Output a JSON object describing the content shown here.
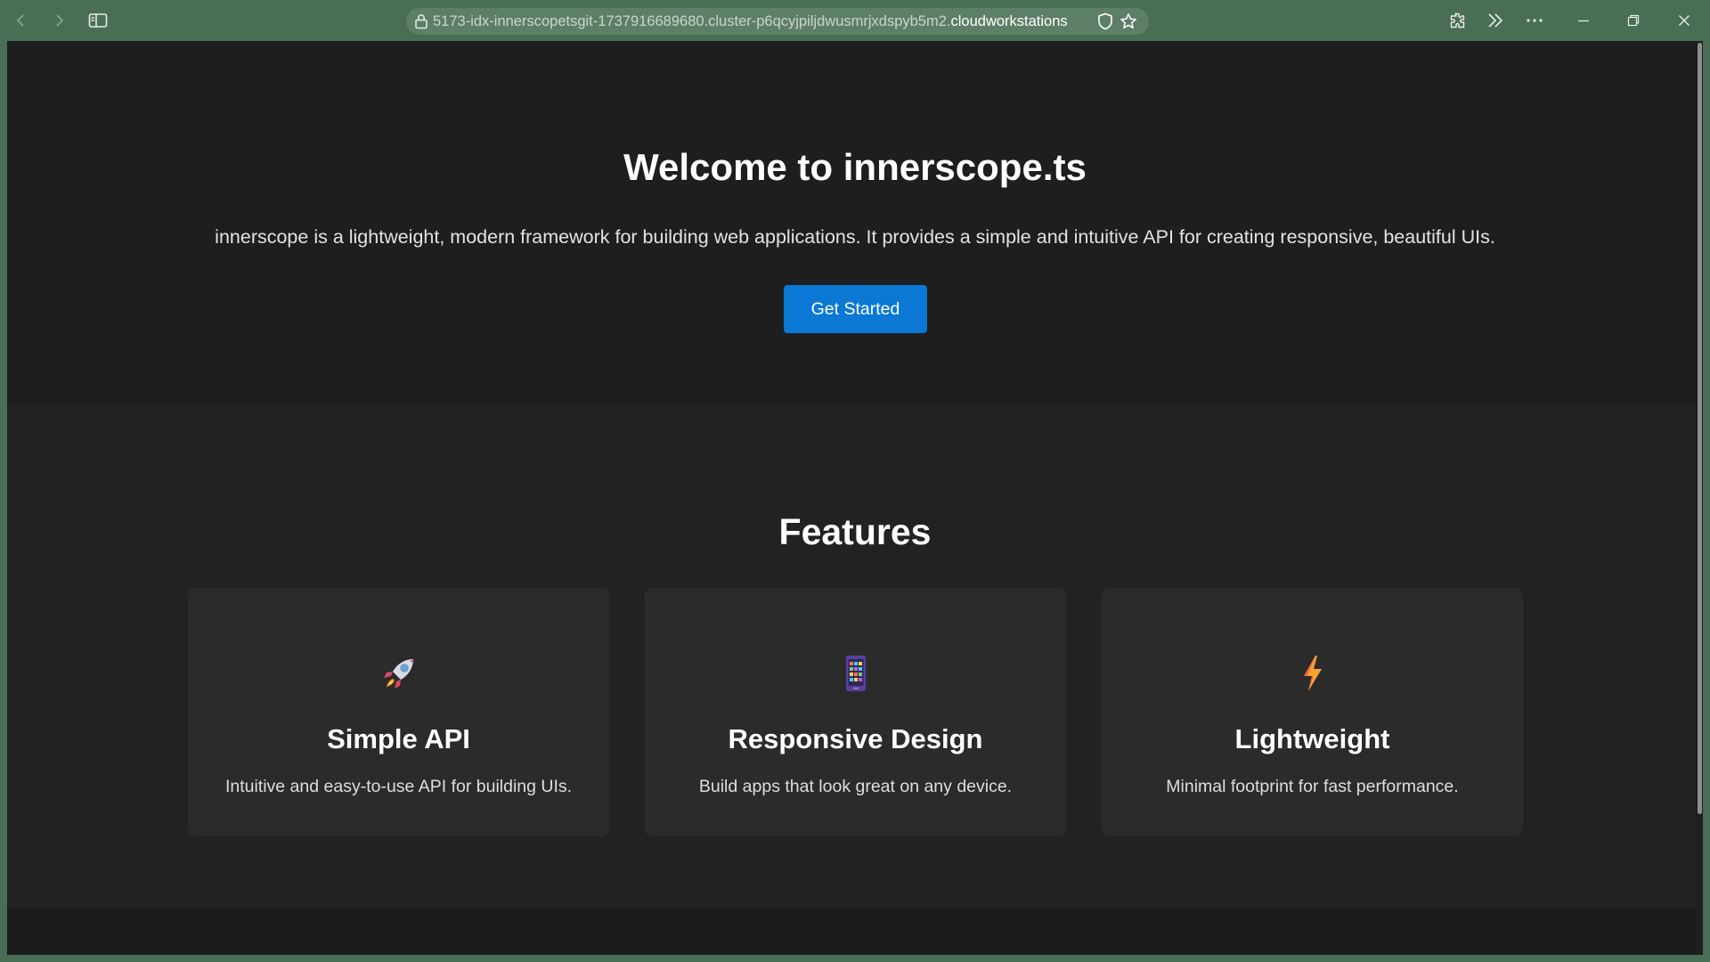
{
  "browser": {
    "url_prefix": "5173-idx-innerscopetsgit-1737916689680.cluster-p6qcyjpiljdwusmrjxdspyb5m2.",
    "url_host": "cloudworkstations",
    "icons": [
      "back-icon",
      "forward-icon",
      "sidebar-icon",
      "lock-icon",
      "shield-icon",
      "star-icon",
      "extensions-icon",
      "more-tools-icon",
      "menu-icon",
      "minimize-icon",
      "restore-icon",
      "close-icon"
    ]
  },
  "hero": {
    "title": "Welcome to innerscope.ts",
    "description": "innerscope is a lightweight, modern framework for building web applications. It provides a simple and intuitive API for creating responsive, beautiful UIs.",
    "cta_label": "Get Started",
    "cta_color": "#0a78d4"
  },
  "features": {
    "heading": "Features",
    "cards": [
      {
        "icon": "rocket-icon",
        "title": "Simple API",
        "description": "Intuitive and easy-to-use API for building UIs."
      },
      {
        "icon": "mobile-phone-icon",
        "title": "Responsive Design",
        "description": "Build apps that look great on any device."
      },
      {
        "icon": "lightning-icon",
        "title": "Lightweight",
        "description": "Minimal footprint for fast performance."
      }
    ]
  },
  "colors": {
    "chrome": "#4a6e55",
    "page_background": "#1e1e1e",
    "card_background": "#2b2b2b"
  }
}
